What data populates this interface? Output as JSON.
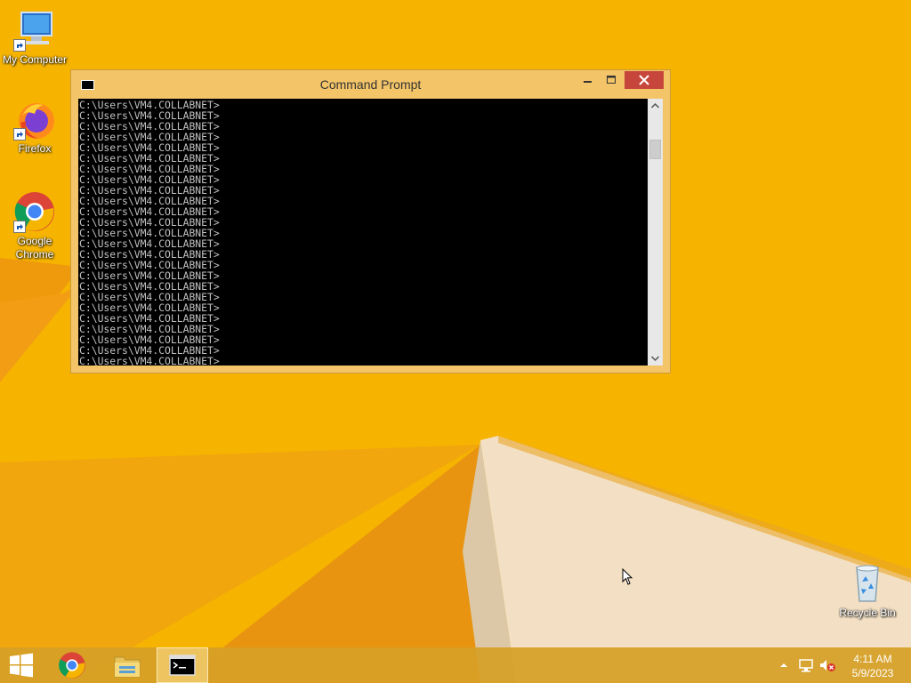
{
  "desktop": {
    "icons": [
      {
        "label": "My Computer"
      },
      {
        "label": "Firefox"
      },
      {
        "label": "Google\nChrome"
      },
      {
        "label": "Recycle Bin"
      }
    ]
  },
  "window": {
    "title": "Command Prompt",
    "console_lines": [
      "C:\\Users\\VM4.COLLABNET>",
      "C:\\Users\\VM4.COLLABNET>",
      "C:\\Users\\VM4.COLLABNET>",
      "C:\\Users\\VM4.COLLABNET>",
      "C:\\Users\\VM4.COLLABNET>",
      "C:\\Users\\VM4.COLLABNET>",
      "C:\\Users\\VM4.COLLABNET>",
      "C:\\Users\\VM4.COLLABNET>",
      "C:\\Users\\VM4.COLLABNET>",
      "C:\\Users\\VM4.COLLABNET>",
      "C:\\Users\\VM4.COLLABNET>",
      "C:\\Users\\VM4.COLLABNET>",
      "C:\\Users\\VM4.COLLABNET>",
      "C:\\Users\\VM4.COLLABNET>",
      "C:\\Users\\VM4.COLLABNET>",
      "C:\\Users\\VM4.COLLABNET>",
      "C:\\Users\\VM4.COLLABNET>",
      "C:\\Users\\VM4.COLLABNET>",
      "C:\\Users\\VM4.COLLABNET>",
      "C:\\Users\\VM4.COLLABNET>",
      "C:\\Users\\VM4.COLLABNET>",
      "C:\\Users\\VM4.COLLABNET>",
      "C:\\Users\\VM4.COLLABNET>",
      "C:\\Users\\VM4.COLLABNET>",
      "C:\\Users\\VM4.COLLABNET>"
    ]
  },
  "taskbar": {
    "clock_time": "4:11 AM",
    "clock_date": "5/9/2023"
  },
  "colors": {
    "wallpaper": "#f6b400",
    "titlebar": "#f4c468",
    "close_button": "#c7463b",
    "taskbar": "#d6a026"
  }
}
